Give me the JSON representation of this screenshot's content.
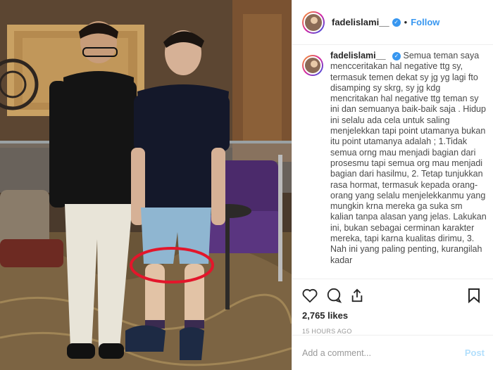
{
  "post": {
    "username": "fadelislami__",
    "verified_icon": "verified-badge-icon",
    "separator": "•",
    "follow_label": "Follow",
    "caption_username": "fadelislami__",
    "caption": "Semua teman saya mencceritakan hal negative ttg sy, termasuk temen dekat sy jg yg lagi fto disamping sy skrg, sy jg kdg mencritakan hal negative ttg teman sy ini dan semuanya baik-baik saja . Hidup ini selalu ada cela untuk saling menjelekkan tapi point utamanya bukan itu point utamanya adalah ; 1.Tidak semua orng mau menjadi bagian dari prosesmu tapi semua org mau menjadi bagian dari hasilmu, 2. Tetap tunjukkan rasa hormat, termasuk kepada orang-orang yang selalu menjelekkanmu yang mungkin krna mereka ga suka sm kalian tanpa alasan yang jelas. Lakukan ini, bukan sebagai cerminan karakter mereka, tapi karna kualitas dirimu, 3. Nah ini yang paling penting, kurangilah kadar",
    "likes": "2,765 likes",
    "timestamp": "15 HOURS AGO",
    "comment_placeholder": "Add a comment...",
    "post_label": "Post"
  },
  "icons": {
    "like": "heart-icon",
    "comment": "comment-icon",
    "share": "share-icon",
    "save": "bookmark-icon"
  },
  "colors": {
    "accent": "#3897f0",
    "highlight_circle": "#e3162b",
    "post_disabled": "#b2dffc"
  }
}
